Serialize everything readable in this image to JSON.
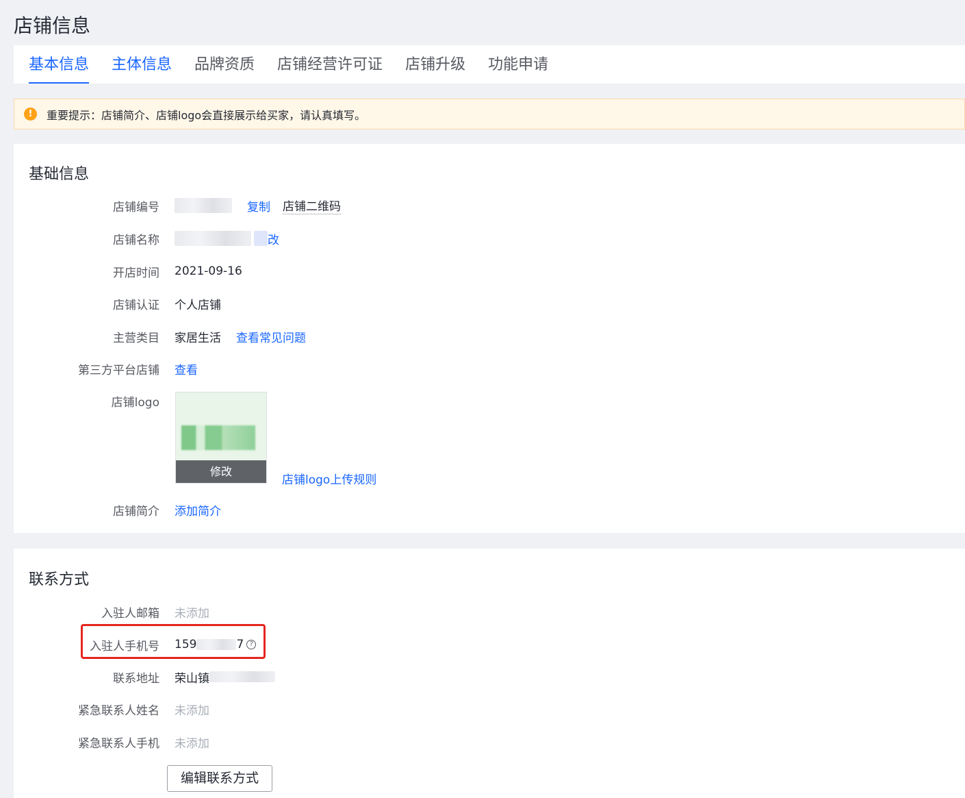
{
  "page": {
    "title": "店铺信息"
  },
  "tabs": [
    {
      "label": "基本信息"
    },
    {
      "label": "主体信息"
    },
    {
      "label": "品牌资质"
    },
    {
      "label": "店铺经营许可证"
    },
    {
      "label": "店铺升级"
    },
    {
      "label": "功能申请"
    }
  ],
  "notice": {
    "icon": "warning-icon",
    "text": "重要提示：店铺简介、店铺logo会直接展示给买家，请认真填写。"
  },
  "basic": {
    "title": "基础信息",
    "shop_id": {
      "label": "店铺编号",
      "copy": "复制",
      "qr": "店铺二维码"
    },
    "shop_name": {
      "label": "店铺名称",
      "edit_suffix": "改"
    },
    "open_time": {
      "label": "开店时间",
      "value": "2021-09-16"
    },
    "certification": {
      "label": "店铺认证",
      "value": "个人店铺"
    },
    "category": {
      "label": "主营类目",
      "value": "家居生活",
      "link": "查看常见问题"
    },
    "third_party": {
      "label": "第三方平台店铺",
      "link": "查看"
    },
    "logo": {
      "label": "店铺logo",
      "edit": "修改",
      "rules": "店铺logo上传规则"
    },
    "intro": {
      "label": "店铺简介",
      "link": "添加简介"
    }
  },
  "contact": {
    "title": "联系方式",
    "email": {
      "label": "入驻人邮箱",
      "value": "未添加"
    },
    "phone": {
      "label": "入驻人手机号",
      "prefix": "159",
      "suffix": "7",
      "icon": "help-icon"
    },
    "address": {
      "label": "联系地址",
      "prefix": "荣山镇"
    },
    "emergency_name": {
      "label": "紧急联系人姓名",
      "value": "未添加"
    },
    "emergency_phone": {
      "label": "紧急联系人手机",
      "value": "未添加"
    },
    "edit_button": "编辑联系方式"
  }
}
